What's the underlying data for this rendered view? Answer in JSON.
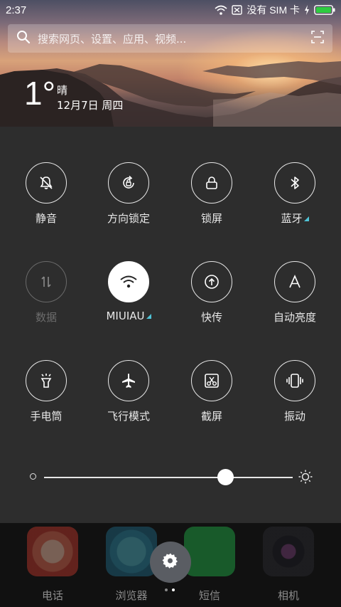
{
  "status_bar": {
    "time": "2:37",
    "sim_text": "没有 SIM 卡",
    "icons": [
      "wifi-icon",
      "no-sim-icon",
      "charging-icon",
      "battery-icon"
    ],
    "battery_color": "#2ecc40"
  },
  "search": {
    "placeholder": "搜索网页、设置、应用、视频..."
  },
  "weather": {
    "temperature": "1°",
    "condition": "晴",
    "date": "12月7日 周四"
  },
  "toggles": [
    {
      "label": "静音",
      "icon": "silent-bell-icon",
      "state": "off"
    },
    {
      "label": "方向锁定",
      "icon": "rotation-lock-icon",
      "state": "off"
    },
    {
      "label": "锁屏",
      "icon": "lock-icon",
      "state": "off"
    },
    {
      "label": "蓝牙",
      "icon": "bluetooth-icon",
      "state": "off",
      "has_menu": true
    },
    {
      "label": "数据",
      "icon": "data-arrows-icon",
      "state": "disabled"
    },
    {
      "label": "MIUIAU",
      "icon": "wifi-icon",
      "state": "on",
      "has_menu": true
    },
    {
      "label": "快传",
      "icon": "quick-transfer-icon",
      "state": "off"
    },
    {
      "label": "自动亮度",
      "icon": "auto-brightness-icon",
      "state": "off"
    },
    {
      "label": "手电筒",
      "icon": "flashlight-icon",
      "state": "off"
    },
    {
      "label": "飞行模式",
      "icon": "airplane-icon",
      "state": "off"
    },
    {
      "label": "截屏",
      "icon": "screenshot-icon",
      "state": "off"
    },
    {
      "label": "振动",
      "icon": "vibrate-icon",
      "state": "off"
    }
  ],
  "brightness": {
    "level": 0.73
  },
  "dock": {
    "apps": [
      {
        "label": "电话",
        "icon": "phone-app-icon"
      },
      {
        "label": "浏览器",
        "icon": "browser-app-icon"
      },
      {
        "label": "短信",
        "icon": "sms-app-icon"
      },
      {
        "label": "相机",
        "icon": "camera-app-icon"
      }
    ],
    "page_count": 2,
    "current_page": 2
  },
  "colors": {
    "accent": "#4fc3d6",
    "panel_bg": "#2d2d2d",
    "active_toggle": "#ffffff"
  }
}
